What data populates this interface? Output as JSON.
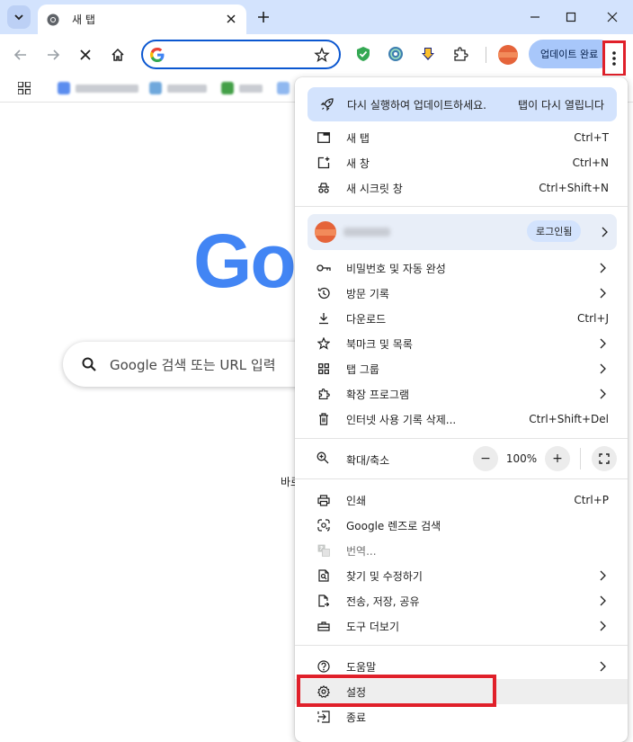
{
  "window": {
    "tab_title": "새 탭",
    "new_tab_symbol": "+"
  },
  "toolbar": {
    "update_button_label": "업데이트 완료"
  },
  "bookmarks": {
    "items_note_hidden": ""
  },
  "page": {
    "logo_visible": "Go",
    "search_placeholder": "Google 검색 또는 URL 입력",
    "shortcut_fragment": "바로"
  },
  "menu": {
    "update_banner": {
      "message": "다시 실행하여 업데이트하세요.",
      "action": "탭이 다시 열립니다"
    },
    "group1": [
      {
        "label": "새 탭",
        "shortcut": "Ctrl+T",
        "icon": "new-tab-icon"
      },
      {
        "label": "새 창",
        "shortcut": "Ctrl+N",
        "icon": "new-window-icon"
      },
      {
        "label": "새 시크릿 창",
        "shortcut": "Ctrl+Shift+N",
        "icon": "incognito-icon"
      }
    ],
    "profile": {
      "badge": "로그인됨"
    },
    "group2": [
      {
        "label": "비밀번호 및 자동 완성",
        "shortcut": "",
        "submenu": true,
        "icon": "key-icon"
      },
      {
        "label": "방문 기록",
        "shortcut": "",
        "submenu": true,
        "icon": "history-icon"
      },
      {
        "label": "다운로드",
        "shortcut": "Ctrl+J",
        "submenu": false,
        "icon": "download-icon"
      },
      {
        "label": "북마크 및 목록",
        "shortcut": "",
        "submenu": true,
        "icon": "star-icon"
      },
      {
        "label": "탭 그룹",
        "shortcut": "",
        "submenu": true,
        "icon": "tab-groups-icon"
      },
      {
        "label": "확장 프로그램",
        "shortcut": "",
        "submenu": true,
        "icon": "puzzle-icon"
      },
      {
        "label": "인터넷 사용 기록 삭제...",
        "shortcut": "Ctrl+Shift+Del",
        "submenu": false,
        "icon": "trash-icon"
      }
    ],
    "zoom": {
      "label": "확대/축소",
      "value": "100%",
      "minus": "−",
      "plus": "+"
    },
    "group3": [
      {
        "label": "인쇄",
        "shortcut": "Ctrl+P",
        "submenu": false,
        "icon": "print-icon"
      },
      {
        "label": "Google 렌즈로 검색",
        "shortcut": "",
        "submenu": false,
        "icon": "lens-icon"
      },
      {
        "label": "번역...",
        "shortcut": "",
        "submenu": false,
        "icon": "translate-icon",
        "disabled": true
      },
      {
        "label": "찾기 및 수정하기",
        "shortcut": "",
        "submenu": true,
        "icon": "find-icon"
      },
      {
        "label": "전송, 저장, 공유",
        "shortcut": "",
        "submenu": true,
        "icon": "share-icon"
      },
      {
        "label": "도구 더보기",
        "shortcut": "",
        "submenu": true,
        "icon": "toolbox-icon"
      }
    ],
    "group4": [
      {
        "label": "도움말",
        "shortcut": "",
        "submenu": true,
        "icon": "help-icon"
      },
      {
        "label": "설정",
        "shortcut": "",
        "submenu": false,
        "icon": "gear-icon"
      },
      {
        "label": "종료",
        "shortcut": "",
        "submenu": false,
        "icon": "exit-icon"
      }
    ]
  },
  "colors": {
    "accent": "#0b57d0",
    "titlebar": "#d3e3fd",
    "highlight_box": "#e0202a"
  }
}
